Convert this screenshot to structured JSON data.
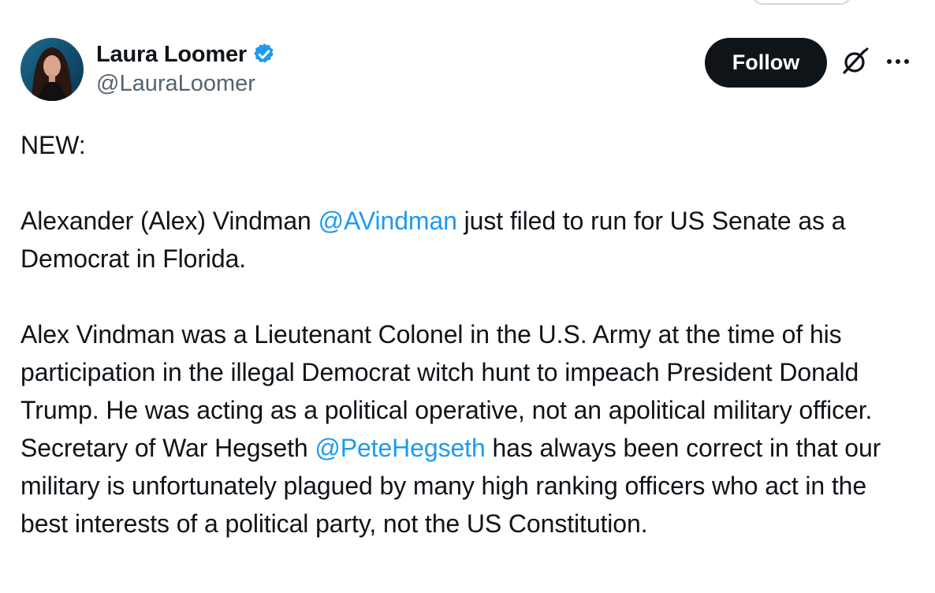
{
  "tweet": {
    "author": {
      "display_name": "Laura Loomer",
      "handle": "@LauraLoomer",
      "verified": true
    },
    "follow_label": "Follow",
    "paragraphs": {
      "p1": "NEW:",
      "p2_before": "Alexander (Alex) Vindman ",
      "p2_mention": "@AVindman",
      "p2_after": " just filed to run for US Senate as a Democrat in Florida.",
      "p3_before": "Alex Vindman was a Lieutenant Colonel in the U.S. Army at the time of his participation in the illegal Democrat witch hunt to impeach President Donald Trump. He was acting as a political operative, not an apolitical military officer. Secretary of War Hegseth ",
      "p3_mention": "@PeteHegseth",
      "p3_after": " has always been correct in that our military is unfortunately plagued by many high ranking officers who act in the best interests of a political party, not the US Constitution."
    }
  },
  "icons": {
    "verified": "verified-badge-icon",
    "grok": "grok-icon",
    "more": "more-options-icon"
  },
  "colors": {
    "text": "#0f1419",
    "secondary": "#536471",
    "link": "#1d9bf0",
    "button_bg": "#0f1419",
    "button_text": "#ffffff",
    "verified": "#1d9bf0"
  }
}
